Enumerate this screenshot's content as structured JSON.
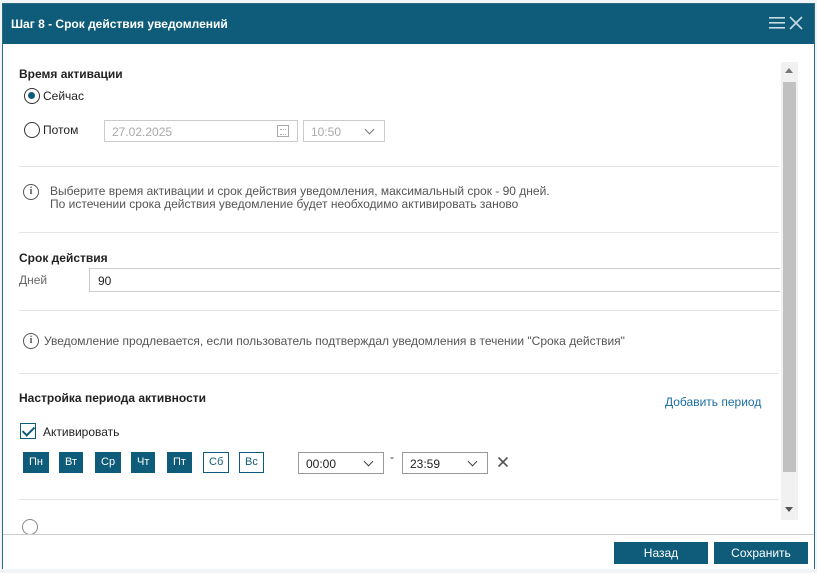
{
  "dialog": {
    "title": "Шаг 8 - Срок действия уведомлений"
  },
  "activation": {
    "title": "Время активации",
    "now_label": "Сейчас",
    "later_label": "Потом",
    "date_value": "27.02.2025",
    "time_value": "10:50",
    "selected": "now"
  },
  "info1": {
    "line1": "Выберите время активации и срок действия уведомления, максимальный срок - 90 дней.",
    "line2": "По истечении срока действия уведомление будет необходимо активировать заново"
  },
  "validity": {
    "title": "Срок действия",
    "days_label": "Дней",
    "days_value": "90"
  },
  "info2": {
    "text": "Уведомление продлевается, если пользователь подтверждал уведомления в течении \"Срока действия\""
  },
  "activity": {
    "title": "Настройка периода активности",
    "add_period": "Добавить период",
    "activate_label": "Активировать",
    "activate_checked": true,
    "days": [
      {
        "label": "Пн",
        "active": true
      },
      {
        "label": "Вт",
        "active": true
      },
      {
        "label": "Ср",
        "active": true
      },
      {
        "label": "Чт",
        "active": true
      },
      {
        "label": "Пт",
        "active": true
      },
      {
        "label": "Сб",
        "active": false
      },
      {
        "label": "Вс",
        "active": false
      }
    ],
    "time_from": "00:00",
    "separator": "-",
    "time_to": "23:59"
  },
  "footer": {
    "back_label": "Назад",
    "save_label": "Сохранить"
  },
  "colors": {
    "primary": "#0f5b7a",
    "link": "#1a6fa3"
  }
}
